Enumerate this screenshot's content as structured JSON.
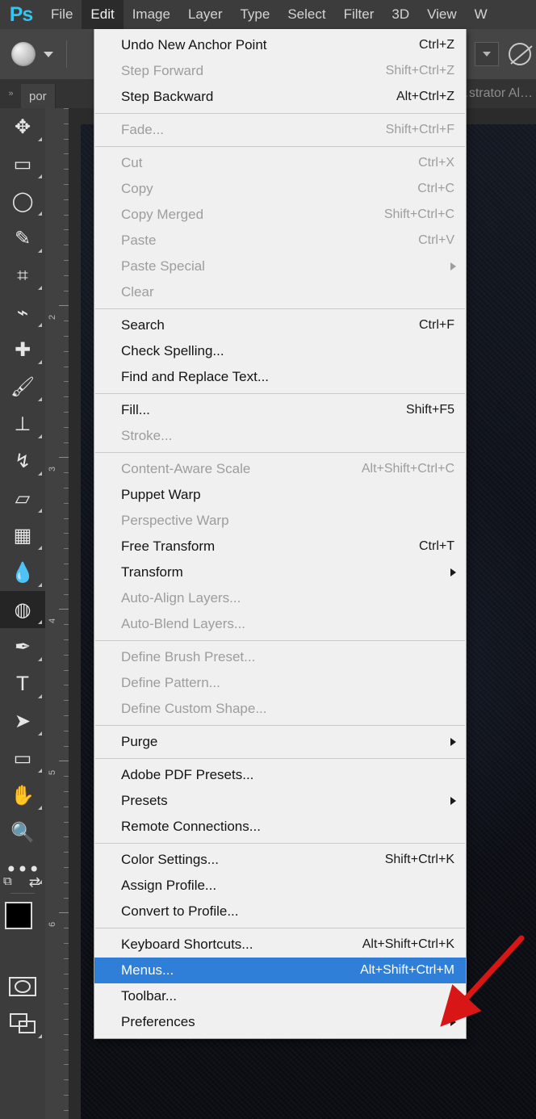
{
  "app": {
    "name": "Ps",
    "window_title": "…strator  Al…"
  },
  "menubar": {
    "items": [
      {
        "label": "File",
        "active": false
      },
      {
        "label": "Edit",
        "active": true
      },
      {
        "label": "Image",
        "active": false
      },
      {
        "label": "Layer",
        "active": false
      },
      {
        "label": "Type",
        "active": false
      },
      {
        "label": "Select",
        "active": false
      },
      {
        "label": "Filter",
        "active": false
      },
      {
        "label": "3D",
        "active": false
      },
      {
        "label": "View",
        "active": false
      },
      {
        "label": "W",
        "active": false
      }
    ]
  },
  "optionsbar": {
    "brush_preset_label": "sponge-brush-preset",
    "brush_dropdown_label": "brush-preset-picker",
    "right_dropdown_label": "options-dropdown",
    "right_icon_label": "no-smoothing-icon"
  },
  "tabbar": {
    "collapse_label": "»",
    "document_tab": "por"
  },
  "toolbar": {
    "tools": [
      {
        "name": "move-tool",
        "glyph": "✥",
        "has_corner": true,
        "selected": false
      },
      {
        "name": "rectangular-marquee-tool",
        "glyph": "▭",
        "has_corner": true,
        "selected": false
      },
      {
        "name": "lasso-tool",
        "glyph": "◯",
        "has_corner": true,
        "selected": false
      },
      {
        "name": "quick-selection-tool",
        "glyph": "✎",
        "has_corner": true,
        "selected": false
      },
      {
        "name": "crop-tool",
        "glyph": "⌗",
        "has_corner": true,
        "selected": false
      },
      {
        "name": "eyedropper-tool",
        "glyph": "⌁",
        "has_corner": true,
        "selected": false
      },
      {
        "name": "spot-healing-brush-tool",
        "glyph": "✚",
        "has_corner": true,
        "selected": false
      },
      {
        "name": "brush-tool",
        "glyph": "🖌",
        "has_corner": true,
        "selected": false
      },
      {
        "name": "clone-stamp-tool",
        "glyph": "⊥",
        "has_corner": true,
        "selected": false
      },
      {
        "name": "history-brush-tool",
        "glyph": "↯",
        "has_corner": true,
        "selected": false
      },
      {
        "name": "eraser-tool",
        "glyph": "▱",
        "has_corner": true,
        "selected": false
      },
      {
        "name": "gradient-tool",
        "glyph": "▦",
        "has_corner": true,
        "selected": false
      },
      {
        "name": "blur-tool",
        "glyph": "💧",
        "has_corner": true,
        "selected": false
      },
      {
        "name": "dodge-sponge-tool",
        "glyph": "◍",
        "has_corner": true,
        "selected": true
      },
      {
        "name": "pen-tool",
        "glyph": "✒",
        "has_corner": true,
        "selected": false
      },
      {
        "name": "horizontal-type-tool",
        "glyph": "T",
        "has_corner": true,
        "selected": false
      },
      {
        "name": "path-selection-tool",
        "glyph": "➤",
        "has_corner": true,
        "selected": false
      },
      {
        "name": "rectangle-tool",
        "glyph": "▭",
        "has_corner": true,
        "selected": false
      },
      {
        "name": "hand-tool",
        "glyph": "✋",
        "has_corner": true,
        "selected": false
      },
      {
        "name": "zoom-tool",
        "glyph": "🔍",
        "has_corner": false,
        "selected": false
      },
      {
        "name": "edit-toolbar-tool",
        "glyph": "•••",
        "has_corner": true,
        "selected": false
      }
    ],
    "default_colors_label": "default-foreground-background-colors",
    "swap_colors_label": "swap-foreground-background-colors",
    "foreground_color": "#000000",
    "background_color": "#ffffff",
    "quick_mask_label": "edit-in-quick-mask-mode",
    "screen_mode_label": "change-screen-mode"
  },
  "ruler": {
    "unit_labels": [
      "2",
      "3",
      "4",
      "5",
      "6"
    ],
    "positions": [
      244,
      432,
      620,
      808,
      996
    ]
  },
  "edit_menu": {
    "title": "Edit",
    "groups": [
      [
        {
          "label": "Undo New Anchor Point",
          "accel": "Ctrl+Z",
          "disabled": false,
          "submenu": false,
          "highlight": false
        },
        {
          "label": "Step Forward",
          "accel": "Shift+Ctrl+Z",
          "disabled": true,
          "submenu": false,
          "highlight": false
        },
        {
          "label": "Step Backward",
          "accel": "Alt+Ctrl+Z",
          "disabled": false,
          "submenu": false,
          "highlight": false
        }
      ],
      [
        {
          "label": "Fade...",
          "accel": "Shift+Ctrl+F",
          "disabled": true,
          "submenu": false,
          "highlight": false
        }
      ],
      [
        {
          "label": "Cut",
          "accel": "Ctrl+X",
          "disabled": true,
          "submenu": false,
          "highlight": false
        },
        {
          "label": "Copy",
          "accel": "Ctrl+C",
          "disabled": true,
          "submenu": false,
          "highlight": false
        },
        {
          "label": "Copy Merged",
          "accel": "Shift+Ctrl+C",
          "disabled": true,
          "submenu": false,
          "highlight": false
        },
        {
          "label": "Paste",
          "accel": "Ctrl+V",
          "disabled": true,
          "submenu": false,
          "highlight": false
        },
        {
          "label": "Paste Special",
          "accel": "",
          "disabled": true,
          "submenu": true,
          "highlight": false
        },
        {
          "label": "Clear",
          "accel": "",
          "disabled": true,
          "submenu": false,
          "highlight": false
        }
      ],
      [
        {
          "label": "Search",
          "accel": "Ctrl+F",
          "disabled": false,
          "submenu": false,
          "highlight": false
        },
        {
          "label": "Check Spelling...",
          "accel": "",
          "disabled": false,
          "submenu": false,
          "highlight": false
        },
        {
          "label": "Find and Replace Text...",
          "accel": "",
          "disabled": false,
          "submenu": false,
          "highlight": false
        }
      ],
      [
        {
          "label": "Fill...",
          "accel": "Shift+F5",
          "disabled": false,
          "submenu": false,
          "highlight": false
        },
        {
          "label": "Stroke...",
          "accel": "",
          "disabled": true,
          "submenu": false,
          "highlight": false
        }
      ],
      [
        {
          "label": "Content-Aware Scale",
          "accel": "Alt+Shift+Ctrl+C",
          "disabled": true,
          "submenu": false,
          "highlight": false
        },
        {
          "label": "Puppet Warp",
          "accel": "",
          "disabled": false,
          "submenu": false,
          "highlight": false
        },
        {
          "label": "Perspective Warp",
          "accel": "",
          "disabled": true,
          "submenu": false,
          "highlight": false
        },
        {
          "label": "Free Transform",
          "accel": "Ctrl+T",
          "disabled": false,
          "submenu": false,
          "highlight": false
        },
        {
          "label": "Transform",
          "accel": "",
          "disabled": false,
          "submenu": true,
          "highlight": false
        },
        {
          "label": "Auto-Align Layers...",
          "accel": "",
          "disabled": true,
          "submenu": false,
          "highlight": false
        },
        {
          "label": "Auto-Blend Layers...",
          "accel": "",
          "disabled": true,
          "submenu": false,
          "highlight": false
        }
      ],
      [
        {
          "label": "Define Brush Preset...",
          "accel": "",
          "disabled": true,
          "submenu": false,
          "highlight": false
        },
        {
          "label": "Define Pattern...",
          "accel": "",
          "disabled": true,
          "submenu": false,
          "highlight": false
        },
        {
          "label": "Define Custom Shape...",
          "accel": "",
          "disabled": true,
          "submenu": false,
          "highlight": false
        }
      ],
      [
        {
          "label": "Purge",
          "accel": "",
          "disabled": false,
          "submenu": true,
          "highlight": false
        }
      ],
      [
        {
          "label": "Adobe PDF Presets...",
          "accel": "",
          "disabled": false,
          "submenu": false,
          "highlight": false
        },
        {
          "label": "Presets",
          "accel": "",
          "disabled": false,
          "submenu": true,
          "highlight": false
        },
        {
          "label": "Remote Connections...",
          "accel": "",
          "disabled": false,
          "submenu": false,
          "highlight": false
        }
      ],
      [
        {
          "label": "Color Settings...",
          "accel": "Shift+Ctrl+K",
          "disabled": false,
          "submenu": false,
          "highlight": false
        },
        {
          "label": "Assign Profile...",
          "accel": "",
          "disabled": false,
          "submenu": false,
          "highlight": false
        },
        {
          "label": "Convert to Profile...",
          "accel": "",
          "disabled": false,
          "submenu": false,
          "highlight": false
        }
      ],
      [
        {
          "label": "Keyboard Shortcuts...",
          "accel": "Alt+Shift+Ctrl+K",
          "disabled": false,
          "submenu": false,
          "highlight": false
        },
        {
          "label": "Menus...",
          "accel": "Alt+Shift+Ctrl+M",
          "disabled": false,
          "submenu": false,
          "highlight": true
        },
        {
          "label": "Toolbar...",
          "accel": "",
          "disabled": false,
          "submenu": false,
          "highlight": false
        },
        {
          "label": "Preferences",
          "accel": "",
          "disabled": false,
          "submenu": true,
          "highlight": false
        }
      ]
    ]
  },
  "annotation": {
    "arrow_label": "red-pointer-arrow",
    "arrow_color": "#d81616",
    "points_at": "Menus..."
  },
  "colors": {
    "menu_highlight": "#2f7fd8",
    "menu_background": "#f0f0f0",
    "chrome_dark": "#3c3c3c",
    "ps_blue": "#31c5f0"
  }
}
